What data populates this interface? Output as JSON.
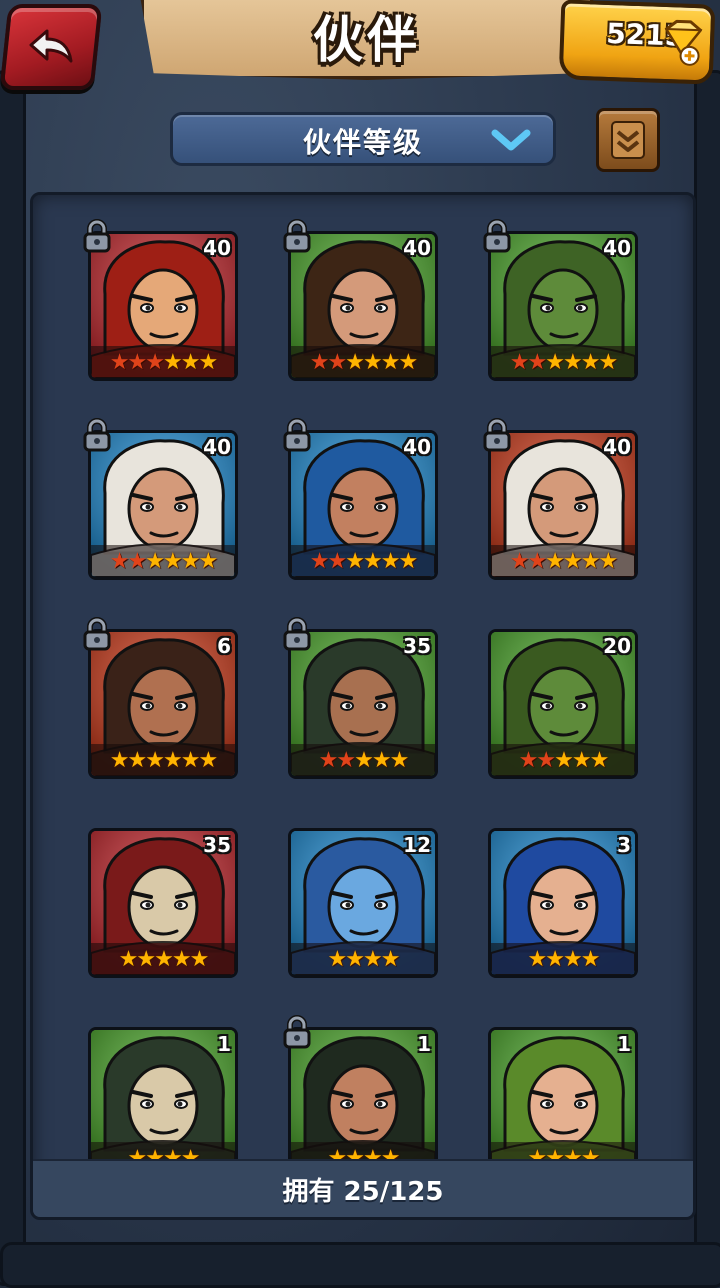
{
  "header": {
    "title": "伙伴",
    "gems": "5215"
  },
  "filter": {
    "selected": "伙伴等级"
  },
  "footer": {
    "owned_text": "拥有 25/125"
  },
  "colors": {
    "panel": "#2a3850",
    "gem_box": "#f0a413",
    "back_button": "#c0262d"
  },
  "partners": [
    {
      "level": "40",
      "locked": true,
      "stars_red": 3,
      "stars_total": 6,
      "bg": "#c2262c",
      "skin": "#e5a878",
      "hair": "#9e1f15",
      "icon": "red-hair-warrior"
    },
    {
      "level": "40",
      "locked": true,
      "stars_red": 2,
      "stars_total": 6,
      "bg": "#4aa52a",
      "skin": "#d49a7a",
      "hair": "#3d2515",
      "icon": "dark-hair-woman"
    },
    {
      "level": "40",
      "locked": true,
      "stars_red": 2,
      "stars_total": 6,
      "bg": "#4aa52a",
      "skin": "#5e8b3a",
      "hair": "#3e6325",
      "icon": "crocodile-beast"
    },
    {
      "level": "40",
      "locked": true,
      "stars_red": 2,
      "stars_total": 6,
      "bg": "#1e8ad0",
      "skin": "#d49a7a",
      "hair": "#e8e4dc",
      "icon": "white-hair-blue-hood"
    },
    {
      "level": "40",
      "locked": true,
      "stars_red": 2,
      "stars_total": 6,
      "bg": "#1e8ad0",
      "skin": "#c28060",
      "hair": "#1f5aa0",
      "icon": "blue-hair-brute"
    },
    {
      "level": "40",
      "locked": true,
      "stars_red": 2,
      "stars_total": 6,
      "bg": "#cc3a1a",
      "skin": "#d49a7a",
      "hair": "#e8e4dc",
      "icon": "white-hair-red-hood"
    },
    {
      "level": "6",
      "locked": true,
      "stars_red": 0,
      "stars_total": 6,
      "bg": "#cc3a1a",
      "skin": "#b07050",
      "hair": "#3a2218",
      "icon": "bearded-barbarian-red"
    },
    {
      "level": "35",
      "locked": true,
      "stars_red": 2,
      "stars_total": 5,
      "bg": "#4aa52a",
      "skin": "#a87050",
      "hair": "#2a3a2a",
      "icon": "bearded-barbarian-green"
    },
    {
      "level": "20",
      "locked": false,
      "stars_red": 2,
      "stars_total": 5,
      "bg": "#4aa52a",
      "skin": "#5e8b3a",
      "hair": "#3a5a20",
      "icon": "boar-orc"
    },
    {
      "level": "35",
      "locked": false,
      "stars_red": 0,
      "stars_total": 5,
      "bg": "#c2262c",
      "skin": "#d9c9a8",
      "hair": "#7a1a1a",
      "icon": "skull-totem-red"
    },
    {
      "level": "12",
      "locked": false,
      "stars_red": 0,
      "stars_total": 4,
      "bg": "#1e8ad0",
      "skin": "#6aa8e0",
      "hair": "#2a5aa0",
      "icon": "blue-lizard"
    },
    {
      "level": "3",
      "locked": false,
      "stars_red": 0,
      "stars_total": 4,
      "bg": "#1e8ad0",
      "skin": "#e5b090",
      "hair": "#1f4aa0",
      "icon": "blue-hair-girl"
    },
    {
      "level": "1",
      "locked": false,
      "stars_red": 0,
      "stars_total": 4,
      "bg": "#4aa52a",
      "skin": "#d9c9a8",
      "hair": "#2a3a2a",
      "icon": "skull-totem-green"
    },
    {
      "level": "1",
      "locked": true,
      "stars_red": 0,
      "stars_total": 4,
      "bg": "#4aa52a",
      "skin": "#c08060",
      "hair": "#1f2a1f",
      "icon": "dark-hair-man"
    },
    {
      "level": "1",
      "locked": false,
      "stars_red": 0,
      "stars_total": 4,
      "bg": "#4aa52a",
      "skin": "#e5b090",
      "hair": "#5a8a2a",
      "icon": "green-hair-girl"
    }
  ]
}
